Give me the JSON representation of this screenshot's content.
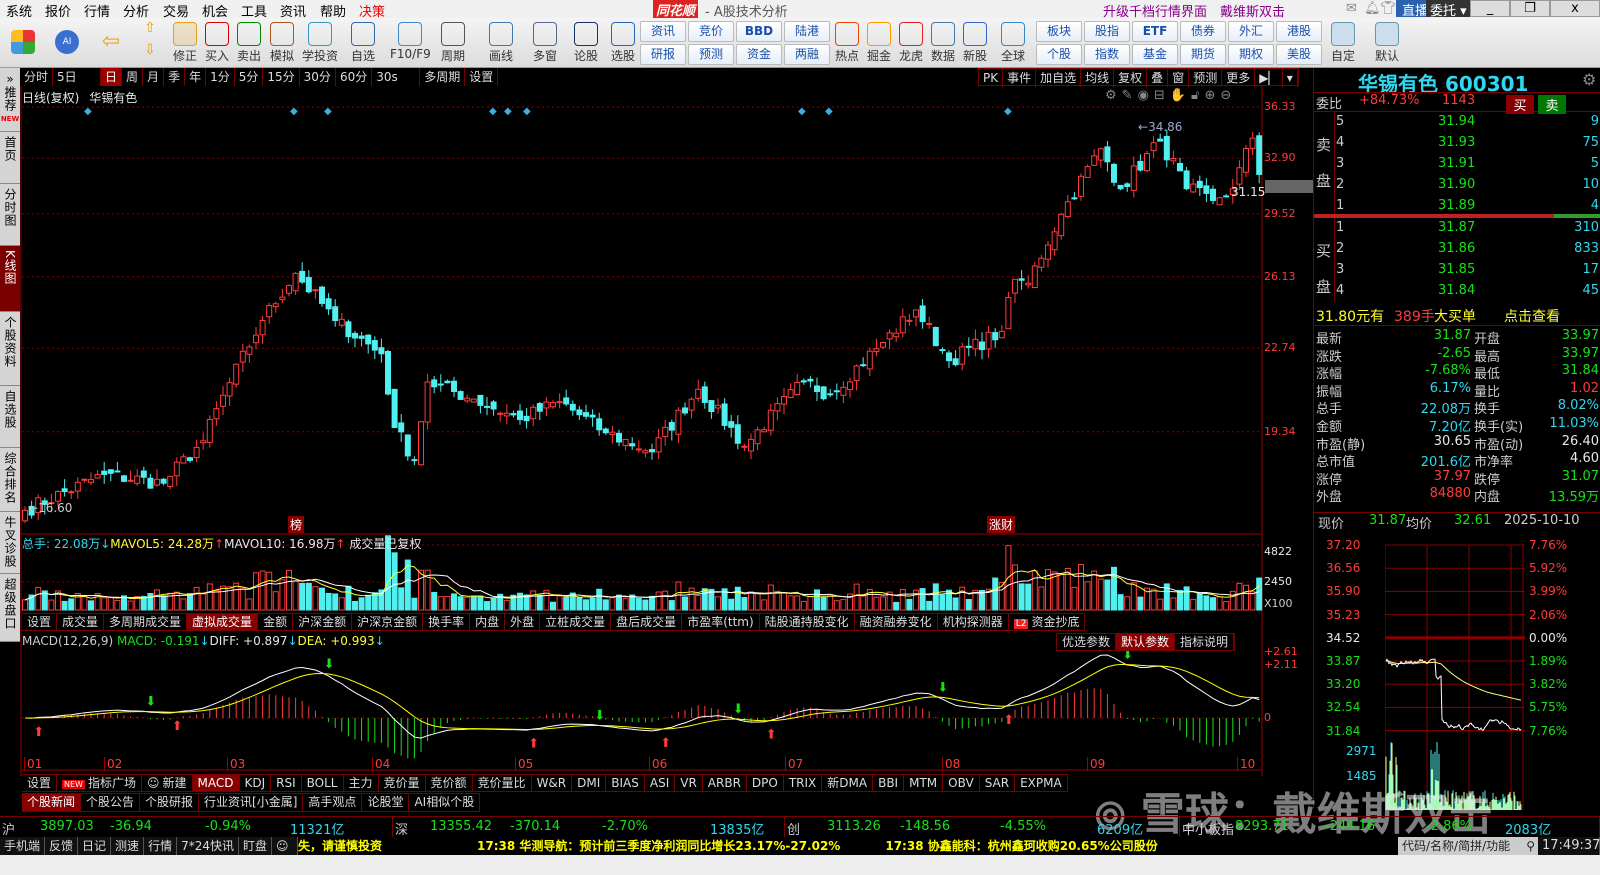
{
  "menu": [
    "系统",
    "报价",
    "行情",
    "分析",
    "交易",
    "机会",
    "工具",
    "资讯",
    "帮助",
    "决策"
  ],
  "title": {
    "brand": "同花顺",
    "subtitle": "- A股技术分析",
    "upgrade": "升级千档行情界面",
    "user": "戴维斯双击",
    "live": "直播",
    "entrust": "委托"
  },
  "toolbar": {
    "icons": [
      "修正",
      "买入",
      "卖出",
      "模拟",
      "学投资",
      "自选",
      "F10/F9",
      "周期",
      "画线",
      "多窗",
      "论股",
      "选股"
    ],
    "pairs1": [
      [
        "资讯",
        "研报"
      ],
      [
        "竞价",
        "预测"
      ],
      [
        "BBD",
        "资金"
      ],
      [
        "陆港",
        "两融"
      ]
    ],
    "icons2": [
      "热点",
      "掘金",
      "龙虎",
      "数据",
      "新股",
      "全球"
    ],
    "pairs2": [
      [
        "板块",
        "个股"
      ],
      [
        "股指",
        "指数"
      ],
      [
        "ETF",
        "基金"
      ],
      [
        "债券",
        "期货"
      ],
      [
        "外汇",
        "期权"
      ],
      [
        "港股",
        "美股"
      ]
    ],
    "icons3": [
      "自定",
      "默认"
    ]
  },
  "sidebar": [
    "推荐",
    "首页",
    "分时图",
    "K线图",
    "个股资料",
    "自选股",
    "综合排名",
    "牛叉诊股",
    "超级盘口"
  ],
  "sidebar_new": "NEW",
  "periods": [
    "分时",
    "5日",
    "日",
    "周",
    "月",
    "季",
    "年",
    "1分",
    "5分",
    "15分",
    "30分",
    "60分",
    "30s",
    "多周期",
    "设置"
  ],
  "right_tools": [
    "PK",
    "事件",
    "加自选",
    "均线",
    "复权",
    "叠",
    "窗",
    "预测",
    "更多"
  ],
  "chart": {
    "title": "日线(复权)",
    "name": "华锡有色",
    "high_label": "34.86",
    "low_label": "16.60",
    "last_label": "31.15",
    "price_ticks": [
      "36.33",
      "32.90",
      "29.52",
      "26.13",
      "22.74",
      "19.34"
    ],
    "markers": [
      "榜",
      "涨财"
    ],
    "months": [
      "01",
      "02",
      "03",
      "04",
      "05",
      "06",
      "07",
      "08",
      "09",
      "10"
    ]
  },
  "kline": {
    "waypoints": [
      [
        0,
        16.6
      ],
      [
        12,
        17.8
      ],
      [
        21,
        17.5
      ],
      [
        27,
        19
      ],
      [
        36,
        24
      ],
      [
        41,
        26.3
      ],
      [
        47,
        24
      ],
      [
        54,
        22.5
      ],
      [
        56,
        19.5
      ],
      [
        59,
        18.3
      ],
      [
        61,
        21.3
      ],
      [
        68,
        20.6
      ],
      [
        75,
        19.8
      ],
      [
        81,
        20.5
      ],
      [
        88,
        19.3
      ],
      [
        95,
        18.6
      ],
      [
        102,
        21
      ],
      [
        109,
        18.8
      ],
      [
        118,
        21.3
      ],
      [
        122,
        20.8
      ],
      [
        130,
        23
      ],
      [
        135,
        24.5
      ],
      [
        140,
        22.2
      ],
      [
        148,
        23.5
      ],
      [
        150,
        26
      ],
      [
        152,
        25.8
      ],
      [
        157,
        29.5
      ],
      [
        163,
        33.5
      ],
      [
        166,
        31
      ],
      [
        172,
        34
      ],
      [
        176,
        31
      ],
      [
        180,
        30.3
      ],
      [
        183,
        31
      ],
      [
        186,
        34.2
      ],
      [
        187,
        31.87
      ]
    ]
  },
  "volume": {
    "total_label": "总手: 22.08万",
    "mavol5": "MAVOL5: 24.28万",
    "mavol10": "MAVOL10: 16.98万",
    "note": "成交量已复权",
    "ticks": [
      "4822",
      "2450",
      "X100"
    ]
  },
  "vol_tabs": [
    "设置",
    "成交量",
    "多周期成交量",
    "虚拟成交量",
    "金额",
    "沪深金额",
    "沪深京金额",
    "换手率",
    "内盘",
    "外盘",
    "立桩成交量",
    "盘后成交量",
    "市盈率(ttm)",
    "陆股通持股变化",
    "融资融券变化",
    "机构探测器",
    "资金抄底"
  ],
  "macd": {
    "name": "MACD(12,26,9)",
    "macd": "MACD: -0.191",
    "diff": "DIFF: +0.897",
    "dea": "DEA: +0.993",
    "ticks": [
      "+2.61",
      "+2.11",
      "0"
    ],
    "buttons": [
      "优选参数",
      "默认参数",
      "指标说明"
    ]
  },
  "ind_tabs": [
    "设置",
    "指标广场",
    "新建",
    "MACD",
    "KDJ",
    "RSI",
    "BOLL",
    "主力",
    "竞价量",
    "竞价额",
    "竞价量比",
    "W&R",
    "DMI",
    "BIAS",
    "ASI",
    "VR",
    "ARBR",
    "DPO",
    "TRIX",
    "新DMA",
    "BBI",
    "MTM",
    "OBV",
    "SAR",
    "EXPMA"
  ],
  "news_tabs": [
    "个股新闻",
    "个股公告",
    "个股研报",
    "行业资讯[小金属]",
    "高手观点",
    "论股堂",
    "AI相似个股"
  ],
  "stock": {
    "name": "华锡有色 600301",
    "weibi_label": "委比",
    "weibi": "+84.73%",
    "weicha": "1143",
    "buy": "买",
    "sell": "卖",
    "asks": [
      [
        "5",
        "31.94",
        "9"
      ],
      [
        "4",
        "31.93",
        "75"
      ],
      [
        "3",
        "31.91",
        "5"
      ],
      [
        "2",
        "31.90",
        "10"
      ],
      [
        "1",
        "31.89",
        "4"
      ]
    ],
    "bids": [
      [
        "1",
        "31.87",
        "310"
      ],
      [
        "2",
        "31.86",
        "833"
      ],
      [
        "3",
        "31.85",
        "17"
      ],
      [
        "4",
        "31.84",
        "45"
      ]
    ],
    "ask_label": [
      "卖",
      "盘"
    ],
    "bid_label": [
      "买",
      "盘"
    ],
    "bigorder": {
      "price": "31.80元有",
      "qty": "389手",
      "label": "大买单",
      "link": "点击查看"
    },
    "stats": [
      [
        "最新",
        "31.87",
        "开盘",
        "33.97"
      ],
      [
        "涨跌",
        "-2.65",
        "最高",
        "33.97"
      ],
      [
        "涨幅",
        "-7.68%",
        "最低",
        "31.84"
      ],
      [
        "振幅",
        "6.17%",
        "量比",
        "1.02"
      ],
      [
        "总手",
        "22.08万",
        "换手",
        "8.02%"
      ],
      [
        "金额",
        "7.20亿",
        "换手(实)",
        "11.03%"
      ],
      [
        "市盈(静)",
        "30.65",
        "市盈(动)",
        "26.40"
      ],
      [
        "总市值",
        "201.6亿",
        "市净率",
        "4.60"
      ],
      [
        "涨停",
        "37.97",
        "跌停",
        "31.07"
      ],
      [
        "外盘",
        "84880",
        "内盘",
        "13.59万"
      ]
    ],
    "intraday": {
      "now_label": "现价",
      "now": "31.87",
      "avg_label": "均价",
      "avg": "32.61",
      "date": "2025-10-10",
      "price_ticks": [
        "37.20",
        "36.56",
        "35.90",
        "35.23",
        "34.52",
        "33.87",
        "33.20",
        "32.54",
        "31.84"
      ],
      "pct_ticks": [
        "7.76%",
        "5.92%",
        "3.99%",
        "2.06%",
        "0.00%",
        "1.89%",
        "3.82%",
        "5.75%",
        "7.76%"
      ],
      "vol_ticks": [
        "2971",
        "1485"
      ]
    }
  },
  "indices": [
    {
      "name": "沪",
      "value": "3897.03",
      "chg": "-36.94",
      "pct": "-0.94%",
      "amt": "11321亿"
    },
    {
      "name": "深",
      "value": "13355.42",
      "chg": "-370.14",
      "pct": "-2.70%",
      "amt": "13835亿"
    },
    {
      "name": "创",
      "value": "3113.26",
      "chg": "-148.56",
      "pct": "-4.55%",
      "amt": "6209亿"
    },
    {
      "name": "中小板指",
      "value": "8293.71",
      "chg": "-244.16",
      "pct": "-2.86%",
      "amt": "2083亿"
    }
  ],
  "statusbar": {
    "items": [
      "手机端",
      "反馈",
      "日记",
      "测速",
      "行情",
      "7*24快讯",
      "盯盘"
    ],
    "ticker": [
      "失，请谨慎投资",
      "17:38 华测导航：预计前三季度净利润同比增长23.17%-27.02%",
      "17:38 协鑫能科：杭州鑫珂收购20.65%公司股份"
    ],
    "search_placeholder": "代码/名称/简拼/功能",
    "clock": "17:49:37"
  },
  "watermark": "雪球：戴维斯双击",
  "colors": {
    "up": "#ff3b3b",
    "down": "#50f0f0",
    "grid": "#700000"
  }
}
